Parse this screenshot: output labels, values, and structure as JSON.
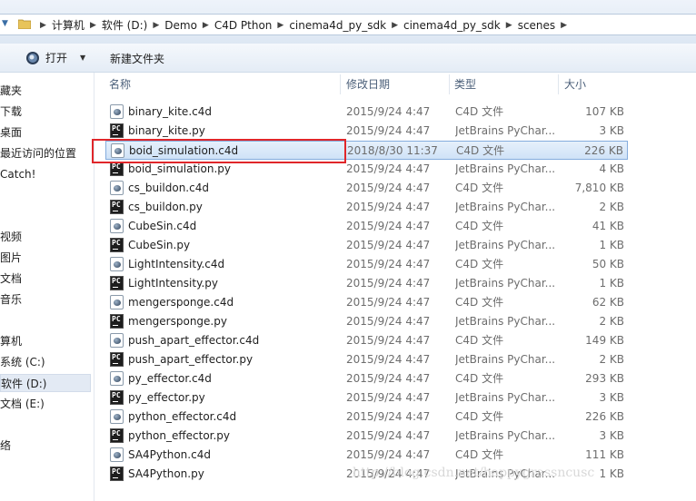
{
  "address_bar": {
    "crumbs": [
      "计算机",
      "软件 (D:)",
      "Demo",
      "C4D Pthon",
      "cinema4d_py_sdk",
      "cinema4d_py_sdk",
      "scenes"
    ]
  },
  "toolbar": {
    "open_label": "打开",
    "new_folder_label": "新建文件夹"
  },
  "sidebar": {
    "items": [
      "藏夹",
      "下载",
      "桌面",
      "最近访问的位置",
      "Catch!",
      "视频",
      "图片",
      "文档",
      "音乐",
      "算机",
      "系统 (C:)",
      "软件 (D:)",
      "文档 (E:)",
      "络"
    ],
    "selected": "软件 (D:)"
  },
  "columns": {
    "name": "名称",
    "date": "修改日期",
    "type": "类型",
    "size": "大小"
  },
  "files": [
    {
      "name": "binary_kite.c4d",
      "date": "2015/9/24 4:47",
      "type": "C4D 文件",
      "size": "107 KB",
      "icon": "c4d-file-icon"
    },
    {
      "name": "binary_kite.py",
      "date": "2015/9/24 4:47",
      "type": "JetBrains PyChar...",
      "size": "3 KB",
      "icon": "pycharm-file-icon"
    },
    {
      "name": "boid_simulation.c4d",
      "date": "2018/8/30 11:37",
      "type": "C4D 文件",
      "size": "226 KB",
      "icon": "c4d-file-icon",
      "selected": true
    },
    {
      "name": "boid_simulation.py",
      "date": "2015/9/24 4:47",
      "type": "JetBrains PyChar...",
      "size": "4 KB",
      "icon": "pycharm-file-icon"
    },
    {
      "name": "cs_buildon.c4d",
      "date": "2015/9/24 4:47",
      "type": "C4D 文件",
      "size": "7,810 KB",
      "icon": "c4d-file-icon"
    },
    {
      "name": "cs_buildon.py",
      "date": "2015/9/24 4:47",
      "type": "JetBrains PyChar...",
      "size": "2 KB",
      "icon": "pycharm-file-icon"
    },
    {
      "name": "CubeSin.c4d",
      "date": "2015/9/24 4:47",
      "type": "C4D 文件",
      "size": "41 KB",
      "icon": "c4d-file-icon"
    },
    {
      "name": "CubeSin.py",
      "date": "2015/9/24 4:47",
      "type": "JetBrains PyChar...",
      "size": "1 KB",
      "icon": "pycharm-file-icon"
    },
    {
      "name": "LightIntensity.c4d",
      "date": "2015/9/24 4:47",
      "type": "C4D 文件",
      "size": "50 KB",
      "icon": "c4d-file-icon"
    },
    {
      "name": "LightIntensity.py",
      "date": "2015/9/24 4:47",
      "type": "JetBrains PyChar...",
      "size": "1 KB",
      "icon": "pycharm-file-icon"
    },
    {
      "name": "mengersponge.c4d",
      "date": "2015/9/24 4:47",
      "type": "C4D 文件",
      "size": "62 KB",
      "icon": "c4d-file-icon"
    },
    {
      "name": "mengersponge.py",
      "date": "2015/9/24 4:47",
      "type": "JetBrains PyChar...",
      "size": "2 KB",
      "icon": "pycharm-file-icon"
    },
    {
      "name": "push_apart_effector.c4d",
      "date": "2015/9/24 4:47",
      "type": "C4D 文件",
      "size": "149 KB",
      "icon": "c4d-file-icon"
    },
    {
      "name": "push_apart_effector.py",
      "date": "2015/9/24 4:47",
      "type": "JetBrains PyChar...",
      "size": "2 KB",
      "icon": "pycharm-file-icon"
    },
    {
      "name": "py_effector.c4d",
      "date": "2015/9/24 4:47",
      "type": "C4D 文件",
      "size": "293 KB",
      "icon": "c4d-file-icon"
    },
    {
      "name": "py_effector.py",
      "date": "2015/9/24 4:47",
      "type": "JetBrains PyChar...",
      "size": "3 KB",
      "icon": "pycharm-file-icon"
    },
    {
      "name": "python_effector.c4d",
      "date": "2015/9/24 4:47",
      "type": "C4D 文件",
      "size": "226 KB",
      "icon": "c4d-file-icon"
    },
    {
      "name": "python_effector.py",
      "date": "2015/9/24 4:47",
      "type": "JetBrains PyChar...",
      "size": "3 KB",
      "icon": "pycharm-file-icon"
    },
    {
      "name": "SA4Python.c4d",
      "date": "2015/9/24 4:47",
      "type": "C4D 文件",
      "size": "111 KB",
      "icon": "c4d-file-icon"
    },
    {
      "name": "SA4Python.py",
      "date": "2015/9/24 4:47",
      "type": "JetBrains PyChar...",
      "size": "1 KB",
      "icon": "pycharm-file-icon"
    }
  ],
  "watermark": "http://blog.csdn.net/happygrassncusc"
}
